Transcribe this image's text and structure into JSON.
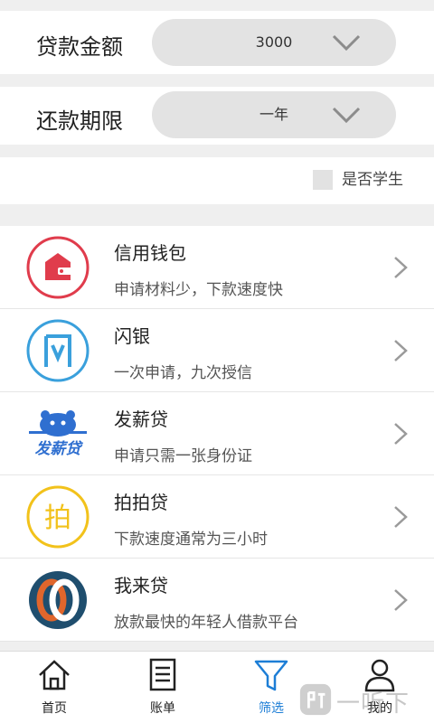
{
  "filters": {
    "amount": {
      "label": "贷款金额",
      "value": "3000"
    },
    "term": {
      "label": "还款期限",
      "value": "一年"
    },
    "student": {
      "label": "是否学生",
      "checked": false
    }
  },
  "lenders": [
    {
      "name": "信用钱包",
      "desc": "申请材料少，下款速度快",
      "logo": "wallet-logo"
    },
    {
      "name": "闪银",
      "desc": "一次申请，九次授信",
      "logo": "shanyin-logo"
    },
    {
      "name": "发薪贷",
      "desc": "申请只需一张身份证",
      "logo": "faxindai-logo",
      "logo_text": "发薪贷"
    },
    {
      "name": "拍拍贷",
      "desc": "下款速度通常为三小时",
      "logo": "paipaidai-logo",
      "logo_text": "拍"
    },
    {
      "name": "我来贷",
      "desc": "放款最快的年轻人借款平台",
      "logo": "wolaidai-logo"
    }
  ],
  "tabs": [
    {
      "label": "首页",
      "icon": "home-icon"
    },
    {
      "label": "账单",
      "icon": "bill-icon"
    },
    {
      "label": "筛选",
      "icon": "filter-icon",
      "active": true
    },
    {
      "label": "我的",
      "icon": "profile-icon"
    }
  ],
  "watermark": {
    "text": "一听下载"
  },
  "colors": {
    "accent": "#1d7ed6",
    "wallet": "#e03c4c",
    "shanyin": "#3aa0dc",
    "paipai": "#f2c21b",
    "wolai_orange": "#e0662c",
    "wolai_navy": "#1f4e6e"
  }
}
